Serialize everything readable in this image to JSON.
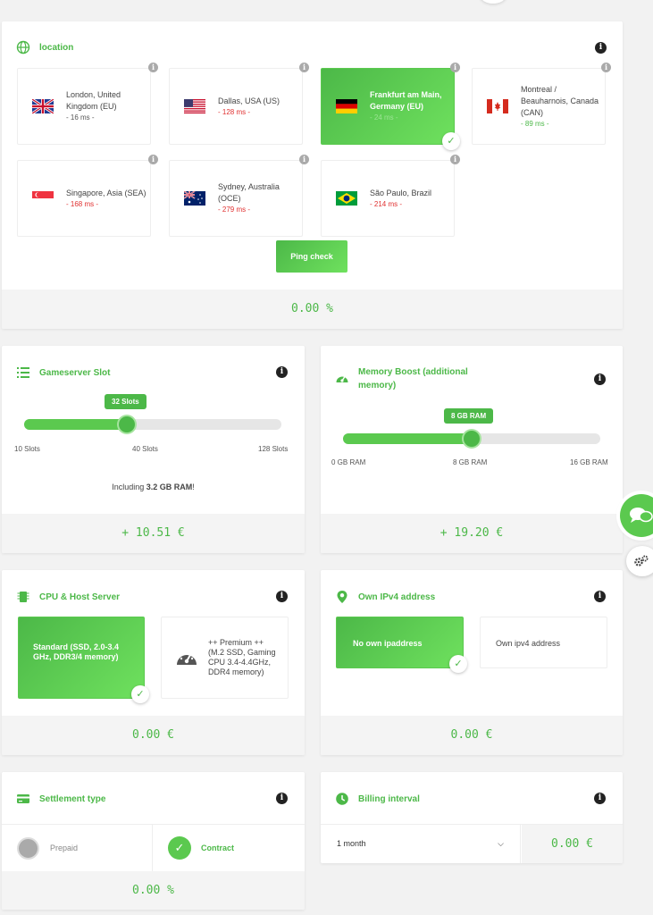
{
  "location": {
    "title": "location",
    "items": [
      {
        "name": "London, United Kingdom (EU)",
        "ms": "- 16 ms -",
        "msColor": "grey",
        "flag": "uk-flag",
        "selected": false
      },
      {
        "name": "Dallas, USA (US)",
        "ms": "- 128 ms -",
        "msColor": "red",
        "flag": "us-flag",
        "selected": false
      },
      {
        "name": "Frankfurt am Main, Germany (EU)",
        "ms": "- 24 ms -",
        "msColor": "light",
        "flag": "de-flag",
        "selected": true
      },
      {
        "name": "Montreal / Beauharnois, Canada (CAN)",
        "ms": "- 89 ms -",
        "msColor": "green",
        "flag": "ca-flag",
        "selected": false
      },
      {
        "name": "Singapore, Asia (SEA)",
        "ms": "- 168 ms -",
        "msColor": "red",
        "flag": "sg-flag",
        "selected": false
      },
      {
        "name": "Sydney, Australia (OCE)",
        "ms": "- 279 ms -",
        "msColor": "red",
        "flag": "au-flag",
        "selected": false
      },
      {
        "name": "São Paulo, Brazil",
        "ms": "- 214 ms -",
        "msColor": "red",
        "flag": "br-flag",
        "selected": false
      }
    ],
    "ping_button": "Ping check",
    "footer": "0.00 %"
  },
  "slots": {
    "title": "Gameserver Slot",
    "value_label": "32 Slots",
    "level": 0.4,
    "ticks": [
      "10 Slots",
      "40 Slots",
      "128 Slots"
    ],
    "note_prefix": "Including ",
    "note_bold": "3.2 GB RAM",
    "note_suffix": "!",
    "footer": "+ 10.51 €"
  },
  "memory": {
    "title": "Memory Boost (additional memory)",
    "value_label": "8 GB RAM",
    "level": 0.5,
    "ticks": [
      "0 GB RAM",
      "8 GB RAM",
      "16 GB RAM"
    ],
    "footer": "+ 19.20 €"
  },
  "cpu": {
    "title": "CPU & Host Server",
    "standard": "Standard (SSD, 2.0-3.4 GHz, DDR3/4 memory)",
    "premium": "++ Premium ++ (M.2 SSD, Gaming CPU 3.4-4.4GHz, DDR4 memory)",
    "footer": "0.00 €"
  },
  "ipv4": {
    "title": "Own IPv4 address",
    "no_ip": "No own ipaddress",
    "own_ip": "Own ipv4 address",
    "footer": "0.00 €"
  },
  "settlement": {
    "title": "Settlement type",
    "prepaid": "Prepaid",
    "contract": "Contract",
    "footer": "0.00 %"
  },
  "billing": {
    "title": "Billing interval",
    "selected": "1 month",
    "price": "0.00 €"
  },
  "colors": {
    "accent": "#4cb848",
    "red": "#e03030"
  }
}
